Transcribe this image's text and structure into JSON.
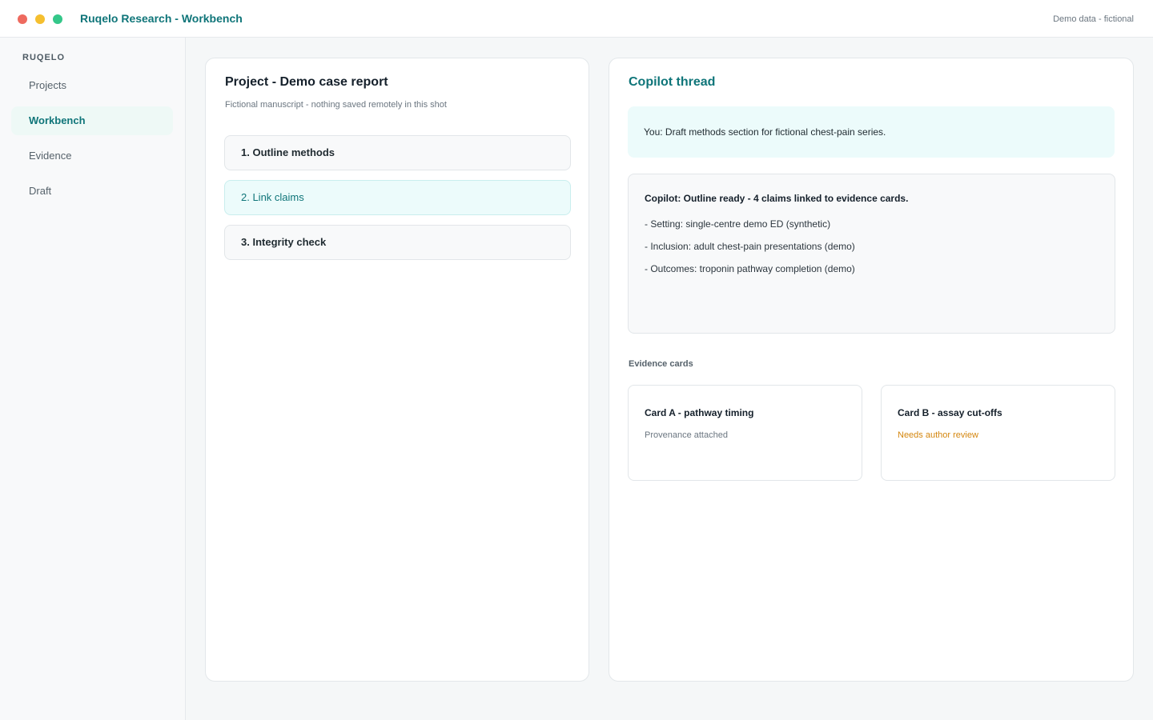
{
  "window": {
    "title": "Ruqelo Research - Workbench",
    "note": "Demo data - fictional"
  },
  "sidebar": {
    "brand": "RUQELO",
    "items": [
      {
        "label": "Projects",
        "active": false
      },
      {
        "label": "Workbench",
        "active": true
      },
      {
        "label": "Evidence",
        "active": false
      },
      {
        "label": "Draft",
        "active": false
      }
    ]
  },
  "project": {
    "title": "Project - Demo case report",
    "subtitle": "Fictional manuscript - nothing saved remotely in this shot",
    "steps": [
      {
        "label": "1. Outline methods",
        "active": false
      },
      {
        "label": "2. Link claims",
        "active": true
      },
      {
        "label": "3. Integrity check",
        "active": false
      }
    ]
  },
  "thread": {
    "title": "Copilot thread",
    "user_message": "You: Draft methods section for fictional chest-pain series.",
    "copilot": {
      "heading": "Copilot: Outline ready - 4 claims linked to evidence cards.",
      "lines": [
        "- Setting: single-centre demo ED (synthetic)",
        "- Inclusion: adult chest-pain presentations (demo)",
        "- Outcomes: troponin pathway completion (demo)"
      ]
    },
    "evidence_label": "Evidence cards",
    "cards": [
      {
        "title": "Card A - pathway timing",
        "status": "Provenance attached"
      },
      {
        "title": "Card B - assay cut-offs",
        "status": "Needs author review"
      }
    ]
  },
  "colors": {
    "accent": "#0f7579",
    "active_bg": "#ecfbfb",
    "warning": "#d4860e",
    "window_red": "#ee6a5f",
    "window_yellow": "#f5bf2f",
    "window_green": "#34c789"
  }
}
